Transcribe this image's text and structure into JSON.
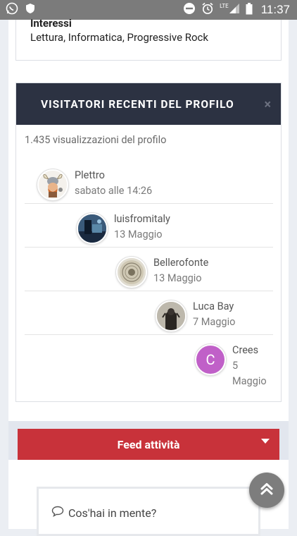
{
  "status_bar": {
    "time": "11:37",
    "network": "LTE",
    "icons": [
      "whatsapp-icon",
      "shield-icon",
      "do-not-disturb-icon",
      "alarm-icon",
      "signal-icon",
      "battery-icon"
    ]
  },
  "interests": {
    "title": "Interessi",
    "value": "Lettura, Informatica, Progressive Rock"
  },
  "visitors_card": {
    "title": "VISITATORI RECENTI DEL PROFILO",
    "close_label": "×",
    "views": "1.435 visualizzazioni del profilo",
    "visitors": [
      {
        "name": "Plettro",
        "date": "sabato alle 14:26"
      },
      {
        "name": "luisfromitaly",
        "date": "13 Maggio"
      },
      {
        "name": "Bellerofonte",
        "date": "13 Maggio"
      },
      {
        "name": "Luca Bay",
        "date": "7 Maggio"
      },
      {
        "name": "Crees",
        "date_line1": "5",
        "date_line2": "Maggio",
        "avatar_letter": "C"
      }
    ]
  },
  "feed": {
    "label": "Feed attività"
  },
  "composer": {
    "placeholder": "Cos'hai in mente?"
  },
  "colors": {
    "header_bg": "#2c3242",
    "feed_red": "#c8323a",
    "avatar_purple": "#c060c8"
  }
}
